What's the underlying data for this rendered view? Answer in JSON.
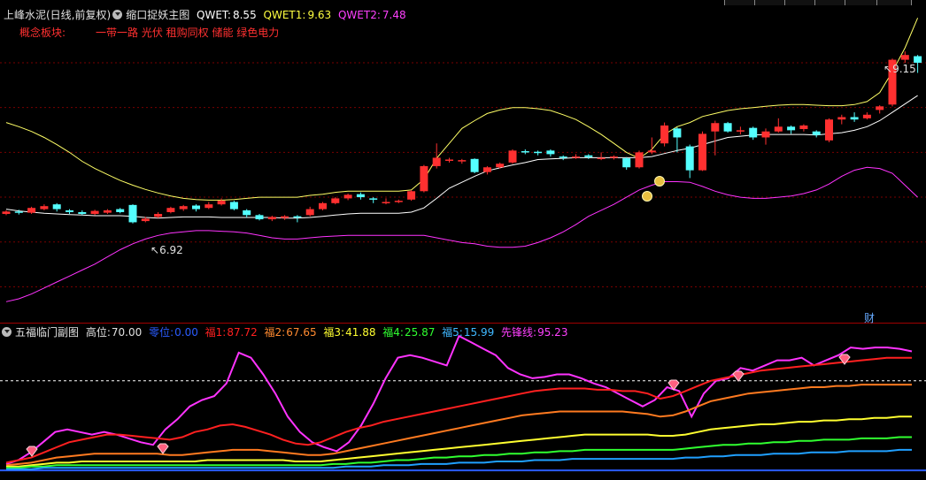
{
  "main": {
    "stock_title": "上峰水泥(日线,前复权)",
    "indicator_name": "缩口捉妖主图",
    "qwet_label": "QWET:",
    "qwet_value": "8.55",
    "qwet1_label": "QWET1:",
    "qwet1_value": "9.63",
    "qwet2_label": "QWET2:",
    "qwet2_value": "7.48",
    "concept_label": "概念板块:",
    "concept_value": "一带一路 光伏 租购同权 储能 绿色电力",
    "low_marker": "6.92",
    "high_marker": "9.15",
    "cai_label": "财"
  },
  "sub": {
    "indicator_name": "五福临门副图",
    "high_label": "高位:",
    "high_value": "70.00",
    "zero_label": "零位:",
    "zero_value": "0.00",
    "fu1_label": "福1:",
    "fu1_value": "87.72",
    "fu2_label": "福2:",
    "fu2_value": "67.65",
    "fu3_label": "福3:",
    "fu3_value": "41.88",
    "fu4_label": "福4:",
    "fu4_value": "25.87",
    "fu5_label": "福5:",
    "fu5_value": "15.99",
    "xian_label": "先锋线:",
    "xian_value": "95.23"
  },
  "colors": {
    "up": "#ff3030",
    "down": "#54ffff",
    "ma": "#ffffff",
    "upper": "#ffff66",
    "lower": "#ff33ff",
    "xian": "#ff33ff",
    "fu1": "#ff2020",
    "fu2": "#ff7a20",
    "fu3": "#ffff30",
    "fu4": "#30ff30",
    "fu5": "#20a0ff",
    "title_qwet": "#ffffff",
    "title_qwet1": "#ffff40",
    "title_qwet2": "#ff40ff",
    "concept": "#ff3030"
  },
  "chart_data": [
    {
      "type": "candlestick",
      "title": "缩口捉妖主图",
      "ylim": [
        5.2,
        10.6
      ],
      "candles": [
        [
          7.02,
          7.06,
          7.08,
          7.0
        ],
        [
          7.06,
          7.04,
          7.09,
          7.01
        ],
        [
          7.04,
          7.12,
          7.14,
          7.02
        ],
        [
          7.1,
          7.15,
          7.18,
          7.08
        ],
        [
          7.18,
          7.1,
          7.2,
          7.06
        ],
        [
          7.08,
          7.05,
          7.1,
          7.02
        ],
        [
          7.05,
          7.02,
          7.08,
          7.0
        ],
        [
          7.02,
          7.07,
          7.09,
          7.0
        ],
        [
          7.04,
          7.08,
          7.1,
          7.02
        ],
        [
          7.1,
          7.05,
          7.12,
          7.03
        ],
        [
          7.17,
          6.88,
          7.18,
          6.86
        ],
        [
          6.9,
          6.94,
          6.97,
          6.88
        ],
        [
          6.97,
          7.02,
          7.05,
          6.95
        ],
        [
          7.05,
          7.12,
          7.14,
          7.03
        ],
        [
          7.1,
          7.15,
          7.17,
          7.07
        ],
        [
          7.16,
          7.1,
          7.18,
          7.06
        ],
        [
          7.12,
          7.18,
          7.22,
          7.1
        ],
        [
          7.18,
          7.24,
          7.28,
          7.16
        ],
        [
          7.22,
          7.1,
          7.24,
          7.08
        ],
        [
          7.08,
          7.0,
          7.1,
          6.96
        ],
        [
          7.0,
          6.93,
          7.02,
          6.91
        ],
        [
          6.93,
          6.97,
          6.99,
          6.9
        ],
        [
          6.95,
          6.98,
          7.0,
          6.92
        ],
        [
          6.98,
          6.97,
          7.0,
          6.88
        ],
        [
          7.0,
          7.1,
          7.14,
          6.98
        ],
        [
          7.1,
          7.2,
          7.22,
          7.08
        ],
        [
          7.2,
          7.28,
          7.3,
          7.18
        ],
        [
          7.28,
          7.34,
          7.36,
          7.25
        ],
        [
          7.35,
          7.3,
          7.38,
          7.26
        ],
        [
          7.28,
          7.26,
          7.3,
          7.2
        ],
        [
          7.22,
          7.22,
          7.28,
          7.18
        ],
        [
          7.22,
          7.24,
          7.26,
          7.2
        ],
        [
          7.26,
          7.4,
          7.42,
          7.24
        ],
        [
          7.4,
          7.82,
          7.84,
          7.38
        ],
        [
          7.82,
          7.96,
          8.2,
          7.78
        ],
        [
          7.92,
          7.93,
          7.96,
          7.88
        ],
        [
          7.9,
          7.92,
          7.94,
          7.86
        ],
        [
          7.94,
          7.72,
          7.95,
          7.7
        ],
        [
          7.72,
          7.8,
          7.82,
          7.68
        ],
        [
          7.8,
          7.86,
          7.88,
          7.78
        ],
        [
          7.88,
          8.08,
          8.1,
          7.86
        ],
        [
          8.07,
          8.06,
          8.1,
          8.02
        ],
        [
          8.06,
          8.04,
          8.08,
          8.0
        ],
        [
          8.08,
          8.02,
          8.1,
          7.98
        ],
        [
          7.98,
          7.96,
          8.0,
          7.92
        ],
        [
          7.96,
          7.98,
          8.02,
          7.94
        ],
        [
          8.0,
          7.97,
          8.02,
          7.94
        ],
        [
          7.96,
          7.96,
          8.05,
          7.92
        ],
        [
          7.96,
          7.98,
          8.0,
          7.93
        ],
        [
          7.95,
          7.8,
          7.97,
          7.76
        ],
        [
          7.8,
          8.05,
          8.08,
          7.78
        ],
        [
          8.05,
          8.08,
          8.3,
          8.02
        ],
        [
          8.2,
          8.5,
          8.55,
          8.15
        ],
        [
          8.45,
          8.3,
          8.47,
          8.05
        ],
        [
          8.15,
          7.75,
          8.18,
          7.62
        ],
        [
          7.75,
          8.36,
          8.4,
          7.74
        ],
        [
          8.4,
          8.54,
          8.58,
          8.0
        ],
        [
          8.54,
          8.4,
          8.56,
          8.38
        ],
        [
          8.4,
          8.42,
          8.48,
          8.35
        ],
        [
          8.46,
          8.3,
          8.48,
          8.26
        ],
        [
          8.3,
          8.4,
          8.45,
          8.18
        ],
        [
          8.4,
          8.48,
          8.62,
          8.38
        ],
        [
          8.48,
          8.42,
          8.5,
          8.36
        ],
        [
          8.44,
          8.5,
          8.52,
          8.4
        ],
        [
          8.4,
          8.34,
          8.42,
          8.3
        ],
        [
          8.25,
          8.6,
          8.62,
          8.22
        ],
        [
          8.6,
          8.64,
          8.68,
          8.52
        ],
        [
          8.64,
          8.6,
          8.72,
          8.56
        ],
        [
          8.62,
          8.68,
          8.72,
          8.6
        ],
        [
          8.76,
          8.82,
          8.84,
          8.7
        ],
        [
          8.85,
          9.6,
          9.62,
          8.82
        ],
        [
          9.6,
          9.68,
          9.74,
          9.55
        ],
        [
          9.66,
          9.55,
          9.68,
          9.38
        ]
      ],
      "ma": [
        7.1,
        7.07,
        7.05,
        7.03,
        7.02,
        7.01,
        7.0,
        6.99,
        6.99,
        6.99,
        6.98,
        6.96,
        6.95,
        6.96,
        6.97,
        6.97,
        6.97,
        6.96,
        6.96,
        6.96,
        6.96,
        6.96,
        6.95,
        6.95,
        6.96,
        6.98,
        7.0,
        7.02,
        7.03,
        7.03,
        7.03,
        7.03,
        7.05,
        7.12,
        7.28,
        7.45,
        7.55,
        7.65,
        7.74,
        7.79,
        7.84,
        7.88,
        7.93,
        7.94,
        7.95,
        7.96,
        7.96,
        7.96,
        7.96,
        7.96,
        7.96,
        7.98,
        8.03,
        8.08,
        8.12,
        8.18,
        8.24,
        8.3,
        8.32,
        8.34,
        8.35,
        8.35,
        8.35,
        8.35,
        8.34,
        8.36,
        8.38,
        8.42,
        8.48,
        8.58,
        8.72,
        8.86,
        9.0
      ],
      "upper": [
        8.55,
        8.48,
        8.4,
        8.3,
        8.18,
        8.05,
        7.9,
        7.78,
        7.68,
        7.58,
        7.5,
        7.43,
        7.37,
        7.32,
        7.28,
        7.26,
        7.25,
        7.25,
        7.26,
        7.28,
        7.3,
        7.3,
        7.3,
        7.3,
        7.33,
        7.35,
        7.38,
        7.4,
        7.4,
        7.4,
        7.4,
        7.4,
        7.42,
        7.6,
        7.95,
        8.2,
        8.45,
        8.58,
        8.7,
        8.76,
        8.8,
        8.8,
        8.78,
        8.75,
        8.68,
        8.6,
        8.48,
        8.35,
        8.2,
        8.05,
        7.95,
        8.1,
        8.35,
        8.48,
        8.55,
        8.65,
        8.7,
        8.75,
        8.78,
        8.8,
        8.82,
        8.84,
        8.85,
        8.85,
        8.84,
        8.83,
        8.83,
        8.85,
        8.9,
        9.05,
        9.4,
        9.8,
        10.3
      ],
      "lower": [
        5.55,
        5.6,
        5.68,
        5.78,
        5.88,
        5.98,
        6.08,
        6.18,
        6.3,
        6.42,
        6.52,
        6.6,
        6.66,
        6.7,
        6.72,
        6.74,
        6.74,
        6.73,
        6.72,
        6.7,
        6.66,
        6.62,
        6.6,
        6.6,
        6.62,
        6.64,
        6.65,
        6.66,
        6.66,
        6.66,
        6.66,
        6.66,
        6.66,
        6.66,
        6.62,
        6.58,
        6.54,
        6.52,
        6.48,
        6.46,
        6.46,
        6.48,
        6.54,
        6.62,
        6.72,
        6.84,
        6.98,
        7.08,
        7.18,
        7.3,
        7.42,
        7.5,
        7.56,
        7.56,
        7.55,
        7.48,
        7.4,
        7.34,
        7.3,
        7.28,
        7.28,
        7.3,
        7.32,
        7.36,
        7.42,
        7.52,
        7.65,
        7.75,
        7.8,
        7.78,
        7.7,
        7.5,
        7.3
      ]
    },
    {
      "type": "line",
      "title": "五福临门副图",
      "ylim": [
        -2,
        103
      ],
      "reference_lines": [
        70,
        0
      ],
      "series": [
        {
          "name": "先锋线",
          "values": [
            5,
            8,
            14,
            22,
            30,
            32,
            30,
            28,
            30,
            28,
            25,
            22,
            20,
            32,
            40,
            50,
            55,
            58,
            68,
            92,
            88,
            75,
            60,
            42,
            30,
            22,
            18,
            15,
            22,
            35,
            52,
            72,
            88,
            90,
            88,
            85,
            82,
            105,
            100,
            95,
            90,
            80,
            75,
            72,
            73,
            75,
            75,
            72,
            68,
            65,
            60,
            55,
            50,
            55,
            65,
            62,
            42,
            60,
            70,
            72,
            80,
            78,
            82,
            86,
            86,
            88,
            82,
            86,
            90,
            96,
            95,
            96,
            96,
            95,
            93
          ]
        },
        {
          "name": "福1",
          "values": [
            6,
            8,
            10,
            14,
            18,
            22,
            24,
            26,
            28,
            28,
            27,
            26,
            25,
            24,
            26,
            30,
            32,
            35,
            36,
            34,
            31,
            28,
            24,
            21,
            20,
            22,
            26,
            30,
            33,
            35,
            38,
            40,
            42,
            44,
            46,
            48,
            50,
            52,
            54,
            56,
            58,
            60,
            62,
            63,
            64,
            64,
            64,
            63,
            63,
            62,
            62,
            60,
            56,
            58,
            62,
            66,
            70,
            72,
            74,
            76,
            78,
            79,
            80,
            81,
            82,
            83,
            84,
            85,
            86,
            87,
            88,
            88,
            88
          ],
          "x_offset": 0
        },
        {
          "name": "福2",
          "values": [
            4,
            5,
            6,
            8,
            10,
            11,
            12,
            13,
            13,
            13,
            13,
            13,
            13,
            12,
            12,
            13,
            14,
            15,
            16,
            16,
            16,
            15,
            14,
            13,
            12,
            12,
            13,
            15,
            17,
            19,
            21,
            23,
            25,
            27,
            29,
            31,
            33,
            35,
            37,
            39,
            41,
            43,
            44,
            45,
            46,
            46,
            46,
            46,
            46,
            46,
            45,
            44,
            42,
            43,
            46,
            50,
            54,
            56,
            58,
            60,
            61,
            62,
            63,
            64,
            65,
            65,
            66,
            66,
            67,
            67,
            67,
            67,
            67
          ]
        },
        {
          "name": "福3",
          "values": [
            3,
            3,
            4,
            5,
            6,
            6,
            7,
            7,
            7,
            7,
            7,
            7,
            7,
            7,
            7,
            7,
            8,
            8,
            8,
            8,
            8,
            8,
            8,
            7,
            7,
            7,
            8,
            9,
            10,
            11,
            12,
            13,
            14,
            15,
            16,
            17,
            18,
            19,
            20,
            21,
            22,
            23,
            24,
            25,
            26,
            27,
            28,
            28,
            28,
            28,
            28,
            28,
            27,
            27,
            28,
            30,
            32,
            33,
            34,
            35,
            36,
            36,
            37,
            38,
            38,
            39,
            39,
            40,
            40,
            41,
            41,
            42,
            42
          ]
        },
        {
          "name": "福4",
          "values": [
            2,
            2,
            3,
            3,
            4,
            4,
            4,
            4,
            4,
            4,
            4,
            4,
            4,
            4,
            4,
            4,
            4,
            4,
            4,
            4,
            4,
            4,
            4,
            4,
            4,
            4,
            5,
            5,
            6,
            6,
            7,
            8,
            8,
            9,
            10,
            10,
            11,
            11,
            12,
            12,
            13,
            13,
            14,
            14,
            15,
            15,
            16,
            16,
            16,
            16,
            16,
            16,
            16,
            16,
            17,
            18,
            19,
            20,
            20,
            21,
            21,
            22,
            22,
            23,
            23,
            24,
            24,
            24,
            25,
            25,
            25,
            26,
            26
          ]
        },
        {
          "name": "福5",
          "values": [
            1,
            1,
            1,
            2,
            2,
            2,
            2,
            2,
            2,
            2,
            2,
            2,
            2,
            2,
            2,
            2,
            2,
            2,
            2,
            2,
            2,
            2,
            2,
            2,
            2,
            2,
            2,
            3,
            3,
            3,
            4,
            4,
            4,
            5,
            5,
            5,
            6,
            6,
            6,
            7,
            7,
            7,
            8,
            8,
            8,
            9,
            9,
            9,
            9,
            9,
            9,
            9,
            9,
            9,
            10,
            10,
            11,
            11,
            12,
            12,
            12,
            13,
            13,
            13,
            14,
            14,
            14,
            15,
            15,
            15,
            15,
            16,
            16
          ]
        }
      ]
    }
  ]
}
